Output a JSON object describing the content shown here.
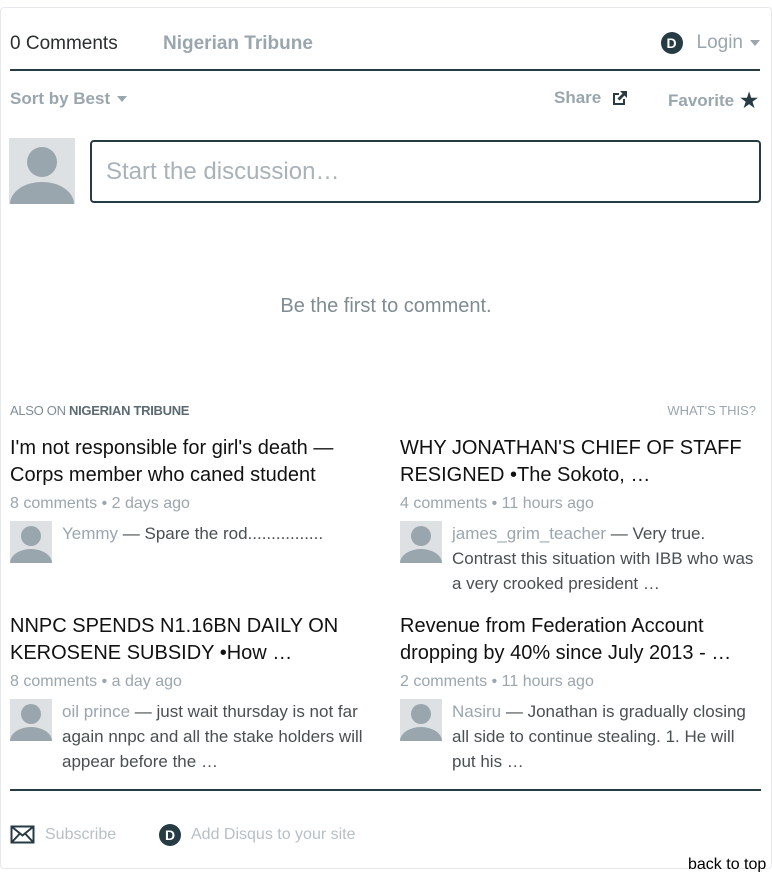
{
  "nav": {
    "comments_tab": "0 Comments",
    "site_tab": "Nigerian Tribune",
    "disqus_badge": "D",
    "login": "Login"
  },
  "toolbar": {
    "sort": "Sort by Best",
    "share": "Share",
    "favorite": "Favorite"
  },
  "composer": {
    "placeholder": "Start the discussion…"
  },
  "empty_message": "Be the first to comment.",
  "also_on": {
    "prefix": "ALSO ON",
    "site": "NIGERIAN TRIBUNE",
    "whats_this": "WHAT'S THIS?",
    "items": [
      {
        "title": "I'm not responsible for girl's death — Corps member who caned student",
        "meta": "8 comments • 2 days ago",
        "author": "Yemmy",
        "text": " — Spare the rod................"
      },
      {
        "title": "WHY JONATHAN'S CHIEF OF STAFF RESIGNED •The Sokoto, …",
        "meta": "4 comments • 11 hours ago",
        "author": "james_grim_teacher",
        "text": " — Very true. Contrast this situation with IBB who was a very crooked president …"
      },
      {
        "title": "NNPC SPENDS N1.16BN DAILY ON KEROSENE SUBSIDY •How …",
        "meta": "8 comments • a day ago",
        "author": "oil prince",
        "text": " — just wait thursday is not far again nnpc and all the stake holders will appear before the …"
      },
      {
        "title": "Revenue from Federation Account dropping by 40% since July 2013 - …",
        "meta": "2 comments • 11 hours ago",
        "author": "Nasiru",
        "text": " — Jonathan is gradually closing all side to continue stealing. 1. He will put his …"
      }
    ]
  },
  "footer": {
    "subscribe": "Subscribe",
    "add_disqus": "Add Disqus to your site",
    "back_to_top": "back to top"
  },
  "colors": {
    "accent": "#263b44",
    "muted": "#9aa6ae",
    "avatar_bg": "#dde1e4"
  }
}
